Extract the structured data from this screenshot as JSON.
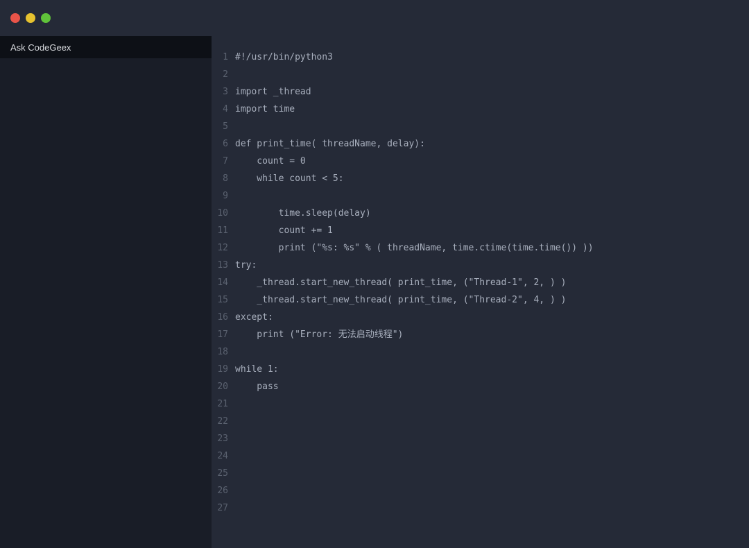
{
  "colors": {
    "titlebar_bg": "#252a37",
    "body_bg": "#191d27",
    "editor_bg": "#252a37",
    "sidebar_tab_bg": "#0d1016",
    "code_fg": "#a8afbd",
    "line_number_fg": "#5b6270",
    "traffic_red": "#e95449",
    "traffic_yellow": "#e6c22f",
    "traffic_green": "#60c33a"
  },
  "sidebar": {
    "tab_label": "Ask CodeGeex"
  },
  "editor": {
    "lines": [
      {
        "n": "1",
        "text": "#!/usr/bin/python3"
      },
      {
        "n": "2",
        "text": ""
      },
      {
        "n": "3",
        "text": "import _thread"
      },
      {
        "n": "4",
        "text": "import time"
      },
      {
        "n": "5",
        "text": ""
      },
      {
        "n": "6",
        "text": "def print_time( threadName, delay):"
      },
      {
        "n": "7",
        "text": "    count = 0"
      },
      {
        "n": "8",
        "text": "    while count < 5:"
      },
      {
        "n": "9",
        "text": ""
      },
      {
        "n": "10",
        "text": "        time.sleep(delay)"
      },
      {
        "n": "11",
        "text": "        count += 1"
      },
      {
        "n": "12",
        "text": "        print (\"%s: %s\" % ( threadName, time.ctime(time.time()) ))"
      },
      {
        "n": "13",
        "text": "try:"
      },
      {
        "n": "14",
        "text": "    _thread.start_new_thread( print_time, (\"Thread-1\", 2, ) )"
      },
      {
        "n": "15",
        "text": "    _thread.start_new_thread( print_time, (\"Thread-2\", 4, ) )"
      },
      {
        "n": "16",
        "text": "except:"
      },
      {
        "n": "17",
        "text": "    print (\"Error: 无法启动线程\")"
      },
      {
        "n": "18",
        "text": ""
      },
      {
        "n": "19",
        "text": "while 1:"
      },
      {
        "n": "20",
        "text": "    pass"
      },
      {
        "n": "21",
        "text": ""
      },
      {
        "n": "22",
        "text": ""
      },
      {
        "n": "23",
        "text": ""
      },
      {
        "n": "24",
        "text": ""
      },
      {
        "n": "25",
        "text": ""
      },
      {
        "n": "26",
        "text": ""
      },
      {
        "n": "27",
        "text": ""
      }
    ]
  }
}
